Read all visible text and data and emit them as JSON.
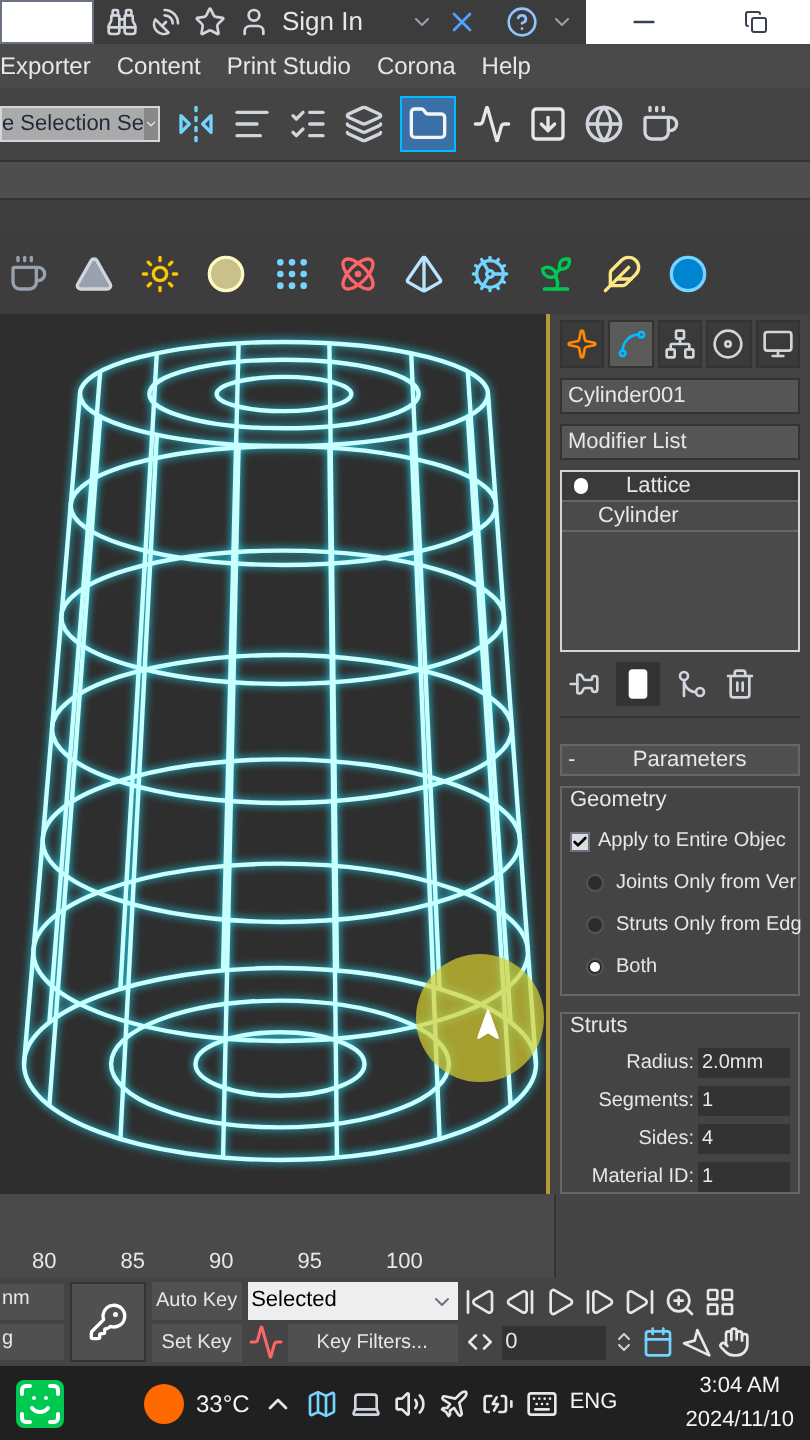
{
  "title_bar": {
    "sign_in": "Sign In"
  },
  "menu": [
    {
      "label": "Exporter"
    },
    {
      "label": "Content"
    },
    {
      "label": "Print Studio"
    },
    {
      "label": "Corona"
    },
    {
      "label": "Help"
    }
  ],
  "main_toolbar": {
    "selection_set": "e Selection Se"
  },
  "command_panel": {
    "tabs": [
      {
        "kind": "create",
        "selected": false
      },
      {
        "kind": "modify",
        "selected": true
      },
      {
        "kind": "hierarchy",
        "selected": false
      },
      {
        "kind": "motion",
        "selected": false
      },
      {
        "kind": "display",
        "selected": false
      }
    ],
    "object_name": "Cylinder001",
    "modifier_list": "Modifier List",
    "stack": [
      {
        "label": "Lattice",
        "selected": true,
        "light": true
      },
      {
        "label": "Cylinder",
        "selected": false,
        "light": false
      }
    ],
    "show_end_result": true
  },
  "parameters": {
    "collapse": "-",
    "title": "Parameters",
    "geometry": {
      "title": "Geometry",
      "apply": {
        "label": "Apply to Entire Objec",
        "checked": true
      },
      "options": [
        {
          "label": "Joints Only from Ver",
          "selected": false
        },
        {
          "label": "Struts Only from Edg",
          "selected": false
        },
        {
          "label": "Both",
          "selected": true
        }
      ]
    },
    "struts": {
      "title": "Struts",
      "fields": [
        {
          "label": "Radius:",
          "value": "2.0mm"
        },
        {
          "label": "Segments:",
          "value": "1"
        },
        {
          "label": "Sides:",
          "value": "4"
        },
        {
          "label": "Material ID:",
          "value": "1"
        }
      ]
    }
  },
  "timeline": {
    "ticks": [
      "80",
      "85",
      "90",
      "95",
      "100"
    ]
  },
  "animation": {
    "left_fields": [
      "nm",
      "g"
    ],
    "auto_key": "Auto Key",
    "set_key": "Set Key",
    "key_mode": "Selected",
    "key_filters": "Key Filters...",
    "frame": "0"
  },
  "taskbar": {
    "temperature": "33°C",
    "language": "ENG",
    "time": "3:04 AM",
    "date": "2024/11/10"
  }
}
